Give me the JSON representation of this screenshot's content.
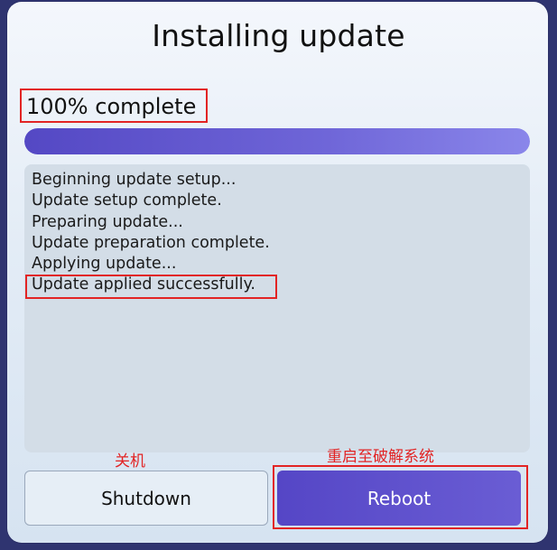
{
  "window": {
    "title": "Installing update"
  },
  "progress": {
    "label": "100% complete",
    "fraction": 1.0
  },
  "log": {
    "lines": [
      "Beginning update setup...",
      "Update setup complete.",
      "Preparing update...",
      "Update preparation complete.",
      "Applying update...",
      "Update applied successfully."
    ]
  },
  "annotations": {
    "shutdown_note": "关机",
    "reboot_note": "重启至破解系统"
  },
  "buttons": {
    "shutdown_label": "Shutdown",
    "reboot_label": "Reboot"
  },
  "colors": {
    "accent": "#5c4fcc",
    "highlight": "#e22424"
  }
}
